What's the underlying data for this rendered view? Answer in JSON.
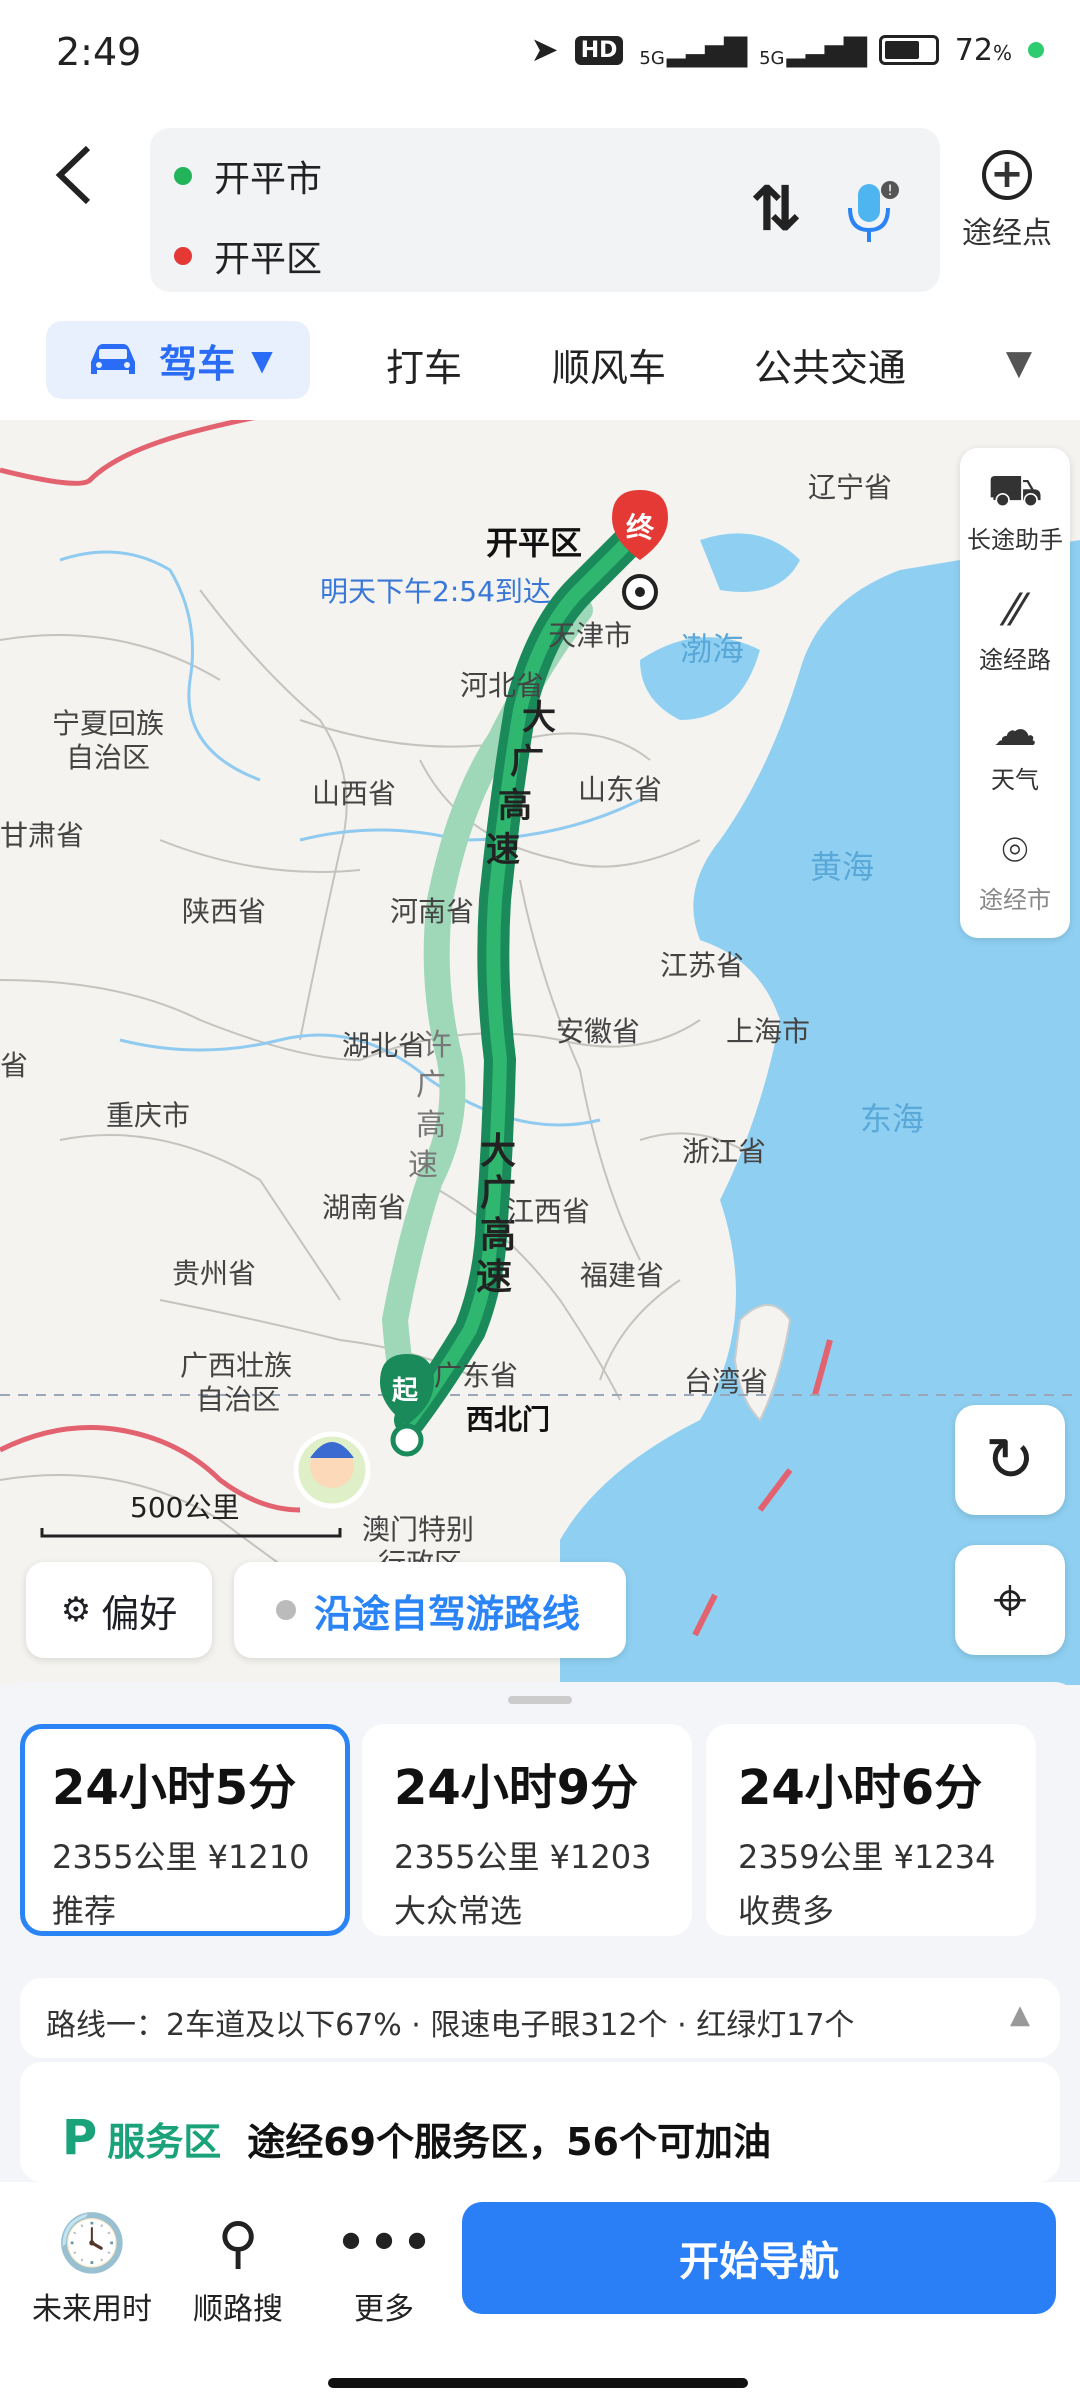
{
  "status_bar": {
    "time": "2:49",
    "hd": "HD",
    "net1": "5G",
    "net2": "5G",
    "battery": "72",
    "battery_unit": "%",
    "battery_level": 0.72
  },
  "header": {
    "origin": "开平市",
    "destination": "开平区",
    "waypoint_label": "途经点",
    "origin_color": "#22b45a",
    "destination_color": "#e53935"
  },
  "modes": {
    "active": "驾车",
    "items": [
      "打车",
      "顺风车",
      "公共交通"
    ]
  },
  "map": {
    "dest_name": "开平区",
    "dest_marker": "终",
    "start_marker": "起",
    "arrival": "明天下午2:54到达",
    "start_name": "西北门",
    "scale": "500公里",
    "road_labels": {
      "main": [
        "大",
        "广",
        "高",
        "速"
      ],
      "alt": [
        "许",
        "广",
        "高",
        "速"
      ]
    },
    "places": [
      "辽宁省",
      "天津市",
      "渤海",
      "河北省",
      "宁夏回族",
      "自治区",
      "山西省",
      "山东省",
      "甘肃省",
      "黄海",
      "陕西省",
      "河南省",
      "江苏省",
      "省",
      "湖北省",
      "安徽省",
      "上海市",
      "重庆市",
      "东海",
      "浙江省",
      "湖南省",
      "江西省",
      "贵州省",
      "福建省",
      "广西壮族",
      "自治区",
      "广东省",
      "台湾省",
      "澳门特别",
      "行政区"
    ],
    "side_panel": [
      "长途助手",
      "途经路",
      "天气",
      "途经市"
    ],
    "chip_preference": "偏好",
    "chip_trip": "沿途自驾游路线",
    "route_color": "#1a8a5a"
  },
  "routes": [
    {
      "time": "24小时5分",
      "dist": "2355公里",
      "cost": "¥1210",
      "tag": "推荐"
    },
    {
      "time": "24小时9分",
      "dist": "2355公里",
      "cost": "¥1203",
      "tag": "大众常选"
    },
    {
      "time": "24小时6分",
      "dist": "2359公里",
      "cost": "¥1234",
      "tag": "收费多"
    }
  ],
  "route_info": "路线一：2车道及以下67% · 限速电子眼312个 · 红绿灯17个",
  "service": {
    "label": "服务区",
    "text": "途经69个服务区，56个可加油"
  },
  "bottom": {
    "items": [
      "未来用时",
      "顺路搜",
      "更多"
    ],
    "nav": "开始导航"
  }
}
